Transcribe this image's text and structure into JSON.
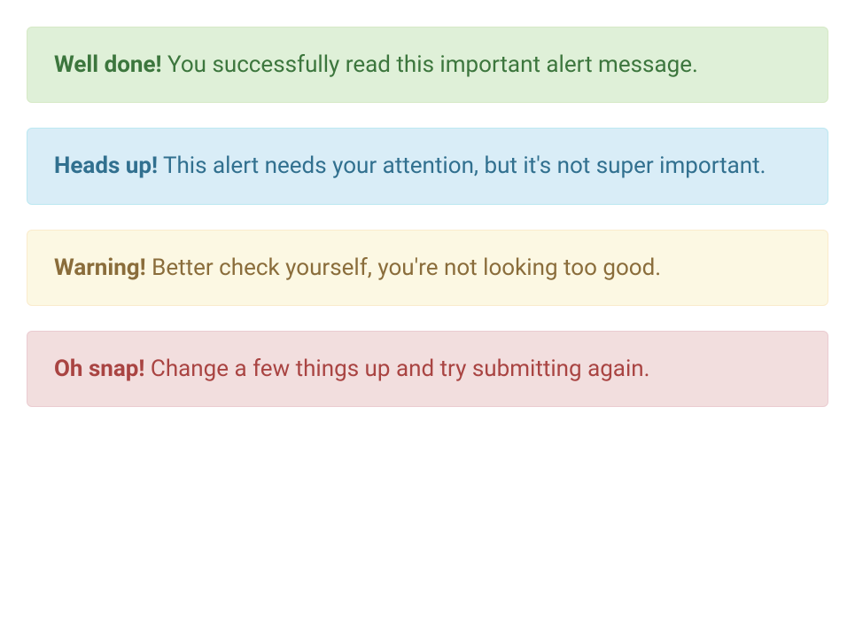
{
  "alerts": {
    "success": {
      "title": "Well done!",
      "message": " You successfully read this important alert message."
    },
    "info": {
      "title": "Heads up!",
      "message": " This alert needs your attention, but it's not super important."
    },
    "warning": {
      "title": "Warning!",
      "message": " Better check yourself, you're not looking too good."
    },
    "danger": {
      "title": "Oh snap!",
      "message": " Change a few things up and try submitting again."
    }
  }
}
